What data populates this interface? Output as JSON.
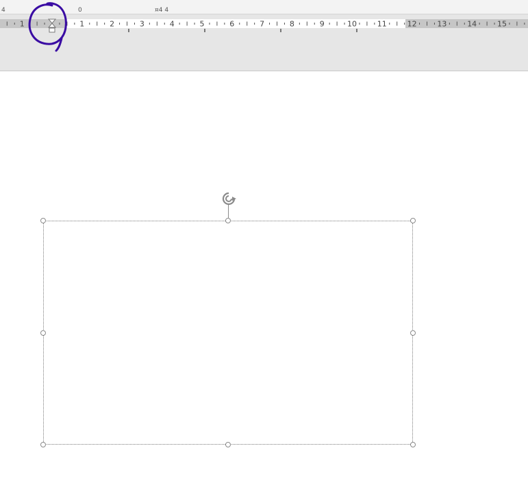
{
  "ribbon": {
    "partial_marks": [
      "4",
      "0",
      "¤4 4"
    ]
  },
  "ruler": {
    "left_margin_labels": [
      "1"
    ],
    "labels": [
      "1",
      "2",
      "3",
      "4",
      "5",
      "6",
      "7",
      "8",
      "9",
      "10",
      "11",
      "12",
      "13",
      "14",
      "15"
    ],
    "indent_marker": "hanging-indent-marker"
  },
  "shape": {
    "type": "text-box",
    "selected": true,
    "content": ""
  },
  "annotation": {
    "type": "hand-drawn circle",
    "color": "#3a0ca3",
    "target": "indent-marker"
  },
  "colors": {
    "ruler_margin": "#c6c6c6",
    "ruler_text_area": "#ffffff",
    "ribbon_background": "#e6e6e6",
    "handle": "#8a8a8a"
  }
}
